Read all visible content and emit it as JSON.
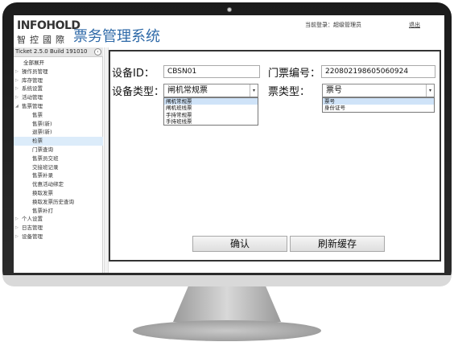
{
  "header": {
    "logo_en": "INFOHOLD",
    "logo_cn": "智控國際",
    "title": "票务管理系统",
    "login_info": "当前登录：超级管理员",
    "logout": "退出"
  },
  "sidebar": {
    "version": "Ticket 2.5.0 Build 191010",
    "collapse_icon": "‹",
    "expand_all": "全部展开",
    "items": [
      {
        "label": "操作员管理",
        "level": "top",
        "arrow": "▷"
      },
      {
        "label": "库存管理",
        "level": "top",
        "arrow": "▷"
      },
      {
        "label": "系统设置",
        "level": "top",
        "arrow": "▷"
      },
      {
        "label": "活动管理",
        "level": "top",
        "arrow": "▷"
      },
      {
        "label": "售票管理",
        "level": "top",
        "arrow": "◢"
      },
      {
        "label": "售票",
        "level": "sub"
      },
      {
        "label": "售票(新)",
        "level": "sub"
      },
      {
        "label": "退票(新)",
        "level": "sub"
      },
      {
        "label": "检票",
        "level": "sub",
        "active": true
      },
      {
        "label": "门票查询",
        "level": "sub"
      },
      {
        "label": "售票员交班",
        "level": "sub"
      },
      {
        "label": "交接班记录",
        "level": "sub"
      },
      {
        "label": "售票补录",
        "level": "sub"
      },
      {
        "label": "优惠活动绑定",
        "level": "sub"
      },
      {
        "label": "换取发票",
        "level": "sub"
      },
      {
        "label": "换取发票历史查询",
        "level": "sub"
      },
      {
        "label": "售票补打",
        "level": "sub"
      },
      {
        "label": "个人设置",
        "level": "top",
        "arrow": "▷"
      },
      {
        "label": "日志管理",
        "level": "top",
        "arrow": "▷"
      },
      {
        "label": "设备管理",
        "level": "top",
        "arrow": "▷"
      }
    ]
  },
  "form": {
    "device_id_label": "设备ID：",
    "device_id_value": "CBSN01",
    "ticket_no_label": "门票编号：",
    "ticket_no_value": "220802198605060924",
    "device_type_label": "设备类型：",
    "device_type_value": "闸机常规票",
    "device_type_options": [
      "闸机常规票",
      "闸机班线票",
      "手持常规票",
      "手持班线票"
    ],
    "ticket_type_label": "票类型：",
    "ticket_type_value": "票号",
    "ticket_type_options": [
      "票号",
      "身份证号"
    ],
    "confirm_button": "确认",
    "refresh_button": "刷新缓存",
    "caret_icon": "▾"
  }
}
